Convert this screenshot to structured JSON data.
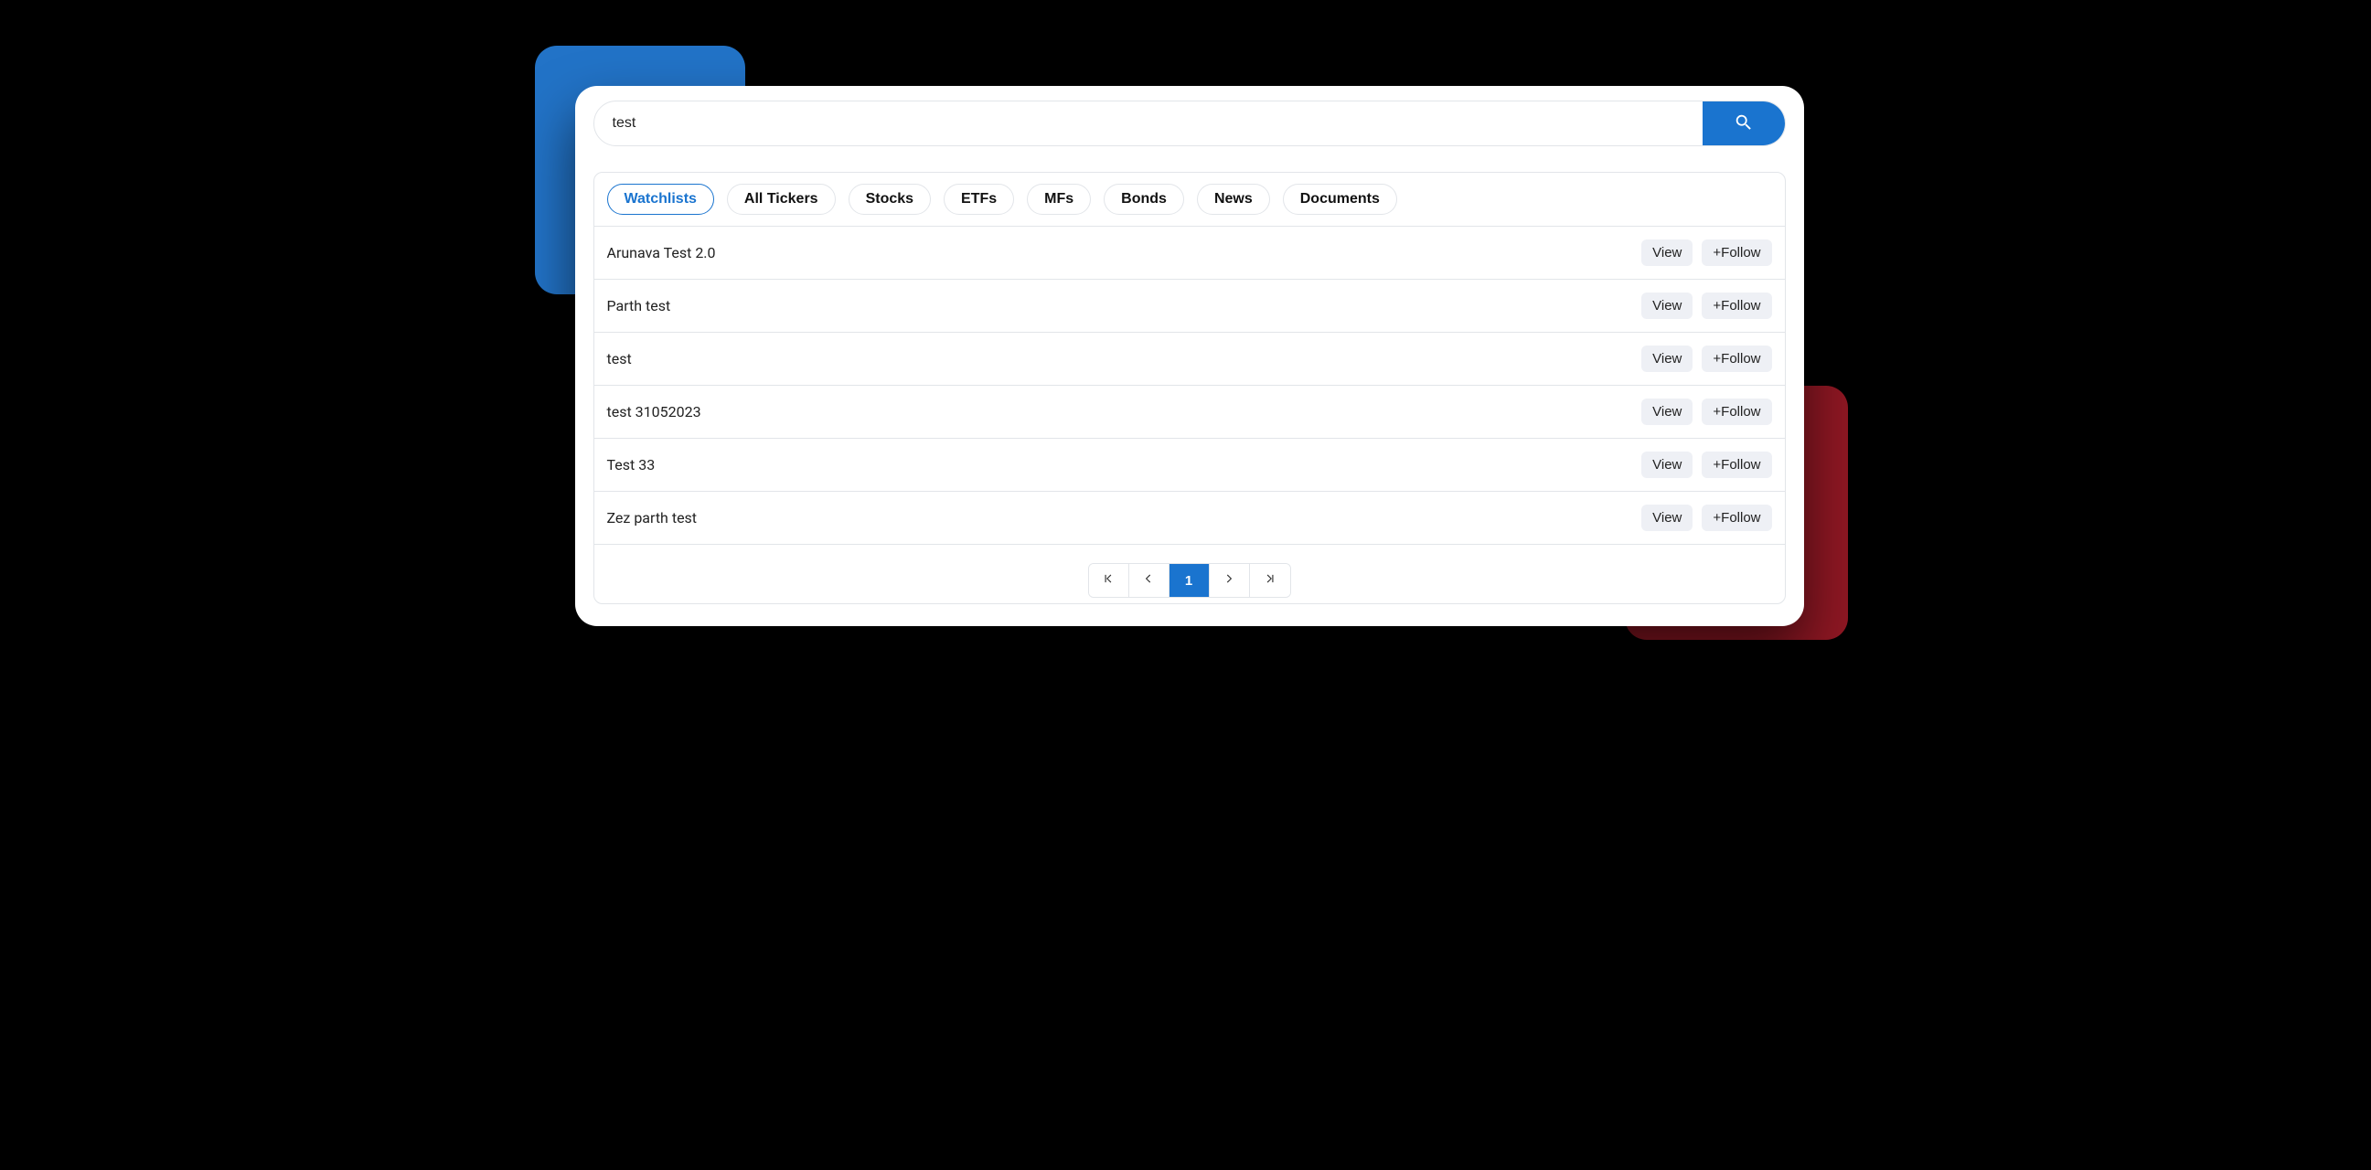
{
  "search": {
    "value": "test"
  },
  "tabs": [
    {
      "label": "Watchlists",
      "active": true
    },
    {
      "label": "All Tickers",
      "active": false
    },
    {
      "label": "Stocks",
      "active": false
    },
    {
      "label": "ETFs",
      "active": false
    },
    {
      "label": "MFs",
      "active": false
    },
    {
      "label": "Bonds",
      "active": false
    },
    {
      "label": "News",
      "active": false
    },
    {
      "label": "Documents",
      "active": false
    }
  ],
  "actions": {
    "view": "View",
    "follow": "+Follow"
  },
  "results": [
    {
      "name": "Arunava Test 2.0"
    },
    {
      "name": "Parth test"
    },
    {
      "name": "test"
    },
    {
      "name": "test 31052023"
    },
    {
      "name": "Test 33"
    },
    {
      "name": "Zez parth test"
    }
  ],
  "pagination": {
    "current": "1"
  }
}
